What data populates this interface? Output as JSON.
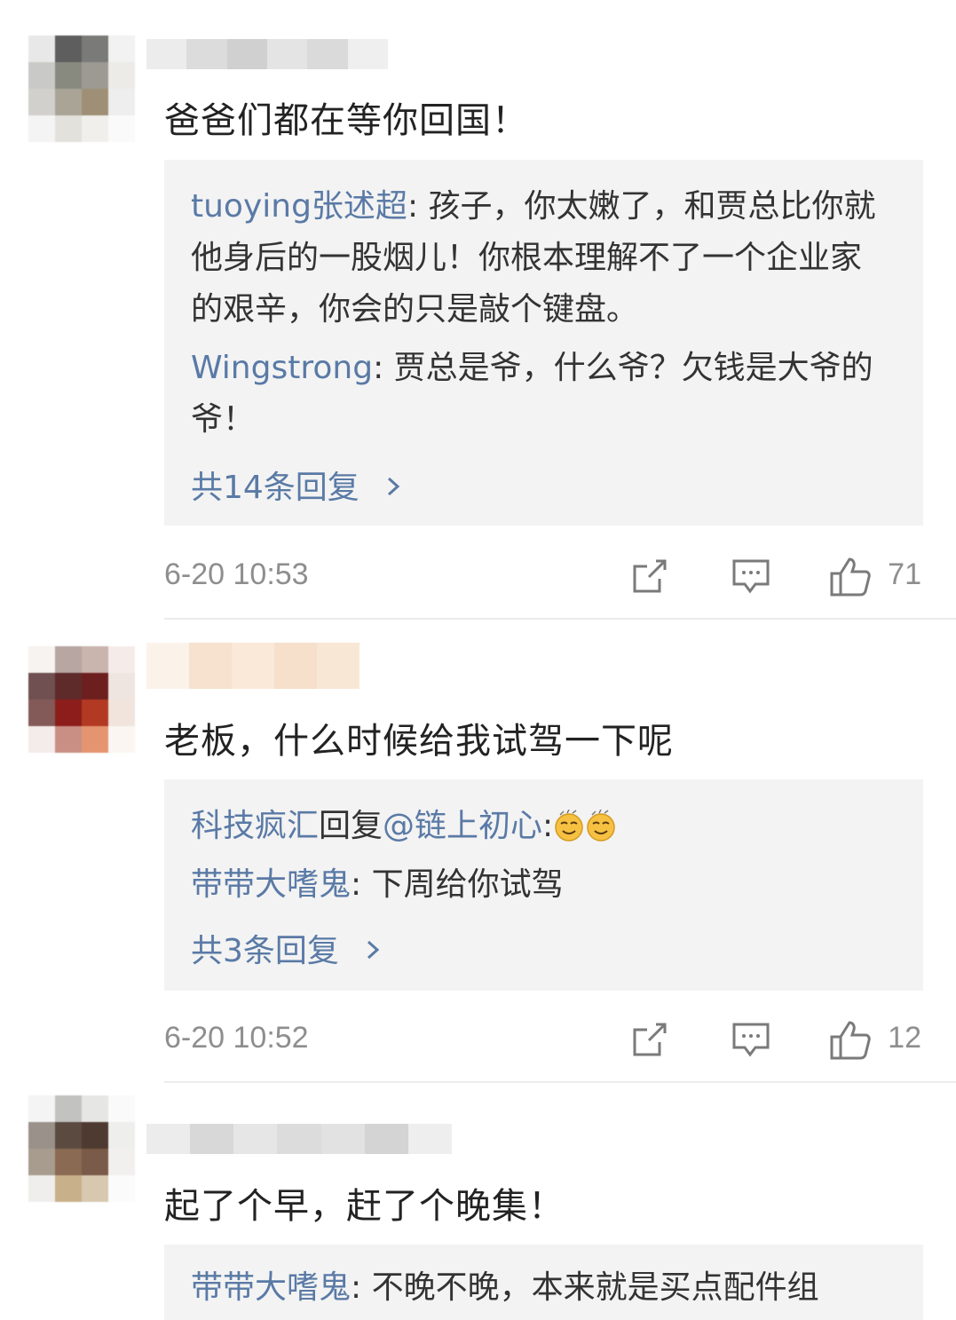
{
  "comments": [
    {
      "text": "爸爸们都在等你回国！",
      "replies": [
        {
          "user": "tuoying张述超",
          "sep": ": ",
          "text": "孩子，你太嫩了，和贾总比你就他身后的一股烟儿！你根本理解不了一个企业家的艰辛，你会的只是敲个键盘。"
        },
        {
          "user": "Wingstrong",
          "sep": ": ",
          "text": "贾总是爷，什么爷？欠钱是大爷的爷！"
        }
      ],
      "more": "共14条回复",
      "time": "6-20 10:53",
      "likes": "71"
    },
    {
      "text": "老板，什么时候给我试驾一下呢",
      "replies": [
        {
          "user": "科技疯汇",
          "mid": "回复",
          "mention": "@链上初心",
          "sep": ":",
          "emoji": "smirk-emoji"
        },
        {
          "user": "带带大嗜鬼",
          "sep": ": ",
          "text": "下周给你试驾"
        }
      ],
      "more": "共3条回复",
      "time": "6-20 10:52",
      "likes": "12"
    },
    {
      "text": "起了个早，赶了个晚集！",
      "replies": [
        {
          "user": "带带大嗜鬼",
          "sep": ": ",
          "text": "不晚不晚，本来就是买点配件组"
        }
      ]
    }
  ],
  "icons": {
    "share": "share-icon",
    "comment": "comment-icon",
    "like": "like-icon",
    "more": "chevron-right-icon"
  },
  "colors": {
    "username": "#5a7aa6",
    "reply_bg": "#f3f3f3",
    "meta": "#8e8e8e"
  }
}
